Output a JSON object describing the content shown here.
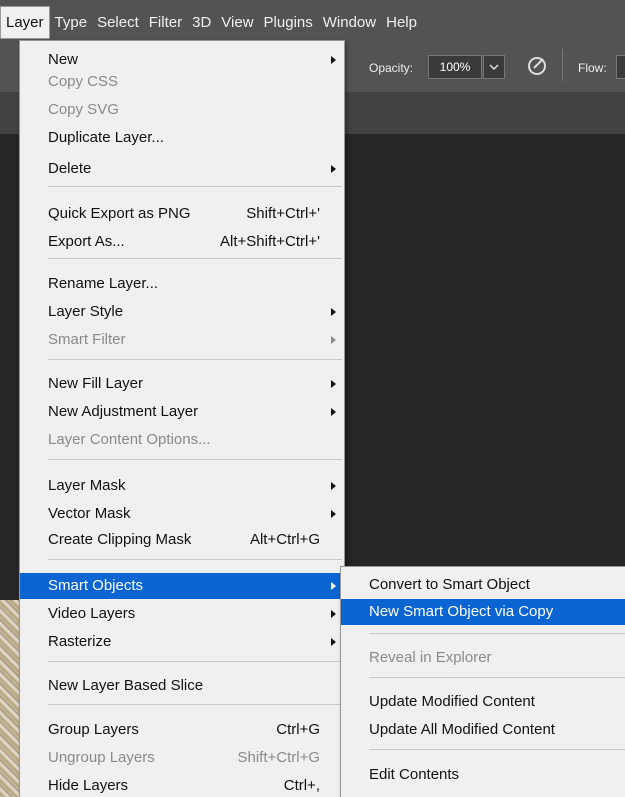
{
  "menubar": {
    "items": [
      {
        "label": "Layer",
        "active": true
      },
      {
        "label": "Type"
      },
      {
        "label": "Select"
      },
      {
        "label": "Filter"
      },
      {
        "label": "3D"
      },
      {
        "label": "View"
      },
      {
        "label": "Plugins"
      },
      {
        "label": "Window"
      },
      {
        "label": "Help"
      }
    ]
  },
  "options_bar": {
    "opacity_label": "Opacity:",
    "opacity_value": "100%",
    "flow_label": "Flow:"
  },
  "layer_menu": {
    "items": [
      {
        "label": "New",
        "submenu": true
      },
      {
        "label": "Copy CSS",
        "disabled": true
      },
      {
        "label": "Copy SVG",
        "disabled": true
      },
      {
        "label": "Duplicate Layer..."
      },
      {
        "label": "Delete",
        "submenu": true
      },
      {
        "label": "Quick Export as PNG",
        "shortcut": "Shift+Ctrl+'"
      },
      {
        "label": "Export As...",
        "shortcut": "Alt+Shift+Ctrl+'"
      },
      {
        "label": "Rename Layer..."
      },
      {
        "label": "Layer Style",
        "submenu": true
      },
      {
        "label": "Smart Filter",
        "disabled": true,
        "submenu": true
      },
      {
        "label": "New Fill Layer",
        "submenu": true
      },
      {
        "label": "New Adjustment Layer",
        "submenu": true
      },
      {
        "label": "Layer Content Options...",
        "disabled": true
      },
      {
        "label": "Layer Mask",
        "submenu": true
      },
      {
        "label": "Vector Mask",
        "submenu": true
      },
      {
        "label": "Create Clipping Mask",
        "shortcut": "Alt+Ctrl+G"
      },
      {
        "label": "Smart Objects",
        "submenu": true,
        "highlighted": true
      },
      {
        "label": "Video Layers",
        "submenu": true
      },
      {
        "label": "Rasterize",
        "submenu": true
      },
      {
        "label": "New Layer Based Slice"
      },
      {
        "label": "Group Layers",
        "shortcut": "Ctrl+G"
      },
      {
        "label": "Ungroup Layers",
        "shortcut": "Shift+Ctrl+G",
        "disabled": true
      },
      {
        "label": "Hide Layers",
        "shortcut": "Ctrl+,"
      }
    ]
  },
  "smart_objects_submenu": {
    "items": [
      {
        "label": "Convert to Smart Object"
      },
      {
        "label": "New Smart Object via Copy",
        "highlighted": true
      },
      {
        "label": "Reveal in Explorer",
        "disabled": true
      },
      {
        "label": "Update Modified Content"
      },
      {
        "label": "Update All Modified Content"
      },
      {
        "label": "Edit Contents"
      }
    ]
  },
  "colors": {
    "highlight": "#0a64d2",
    "menu_bg": "#f0f0f0",
    "app_bg": "#535353"
  }
}
